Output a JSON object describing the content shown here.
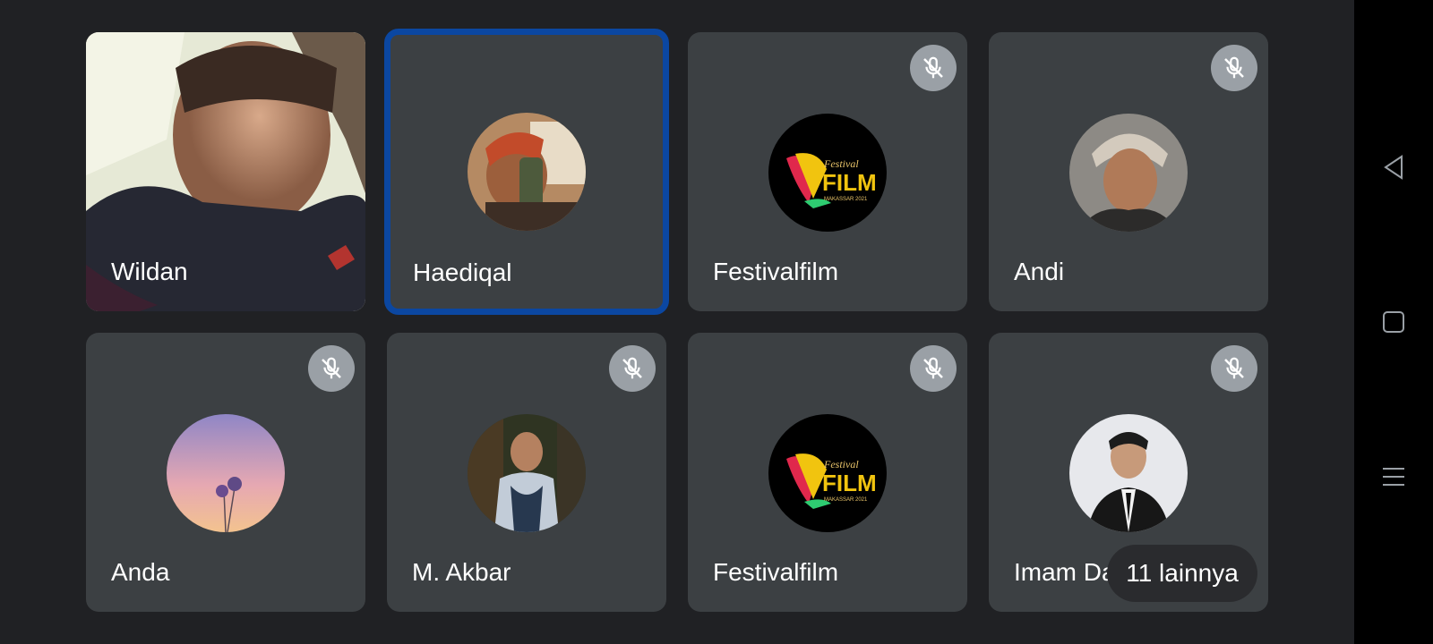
{
  "participants": [
    {
      "name": "Wildan",
      "muted": false,
      "display": "video",
      "avatar_icon": "camera-video-feed"
    },
    {
      "name": "Haediqal",
      "muted": false,
      "active_speaker": true,
      "display": "avatar",
      "avatar_icon": "person-avatar-photo"
    },
    {
      "name": "Festivalfilm",
      "muted": true,
      "display": "avatar",
      "avatar_icon": "festival-film-logo",
      "logo_text": {
        "top": "Festival",
        "main": "FILM",
        "sub": "MAKASSAR 2021"
      }
    },
    {
      "name": "Andi",
      "muted": true,
      "display": "avatar",
      "avatar_icon": "person-avatar-photo"
    },
    {
      "name": "Anda",
      "muted": true,
      "display": "avatar",
      "avatar_icon": "flower-avatar-photo"
    },
    {
      "name": "M. Akbar",
      "muted": true,
      "display": "avatar",
      "avatar_icon": "person-avatar-photo"
    },
    {
      "name": "Festivalfilm",
      "muted": true,
      "display": "avatar",
      "avatar_icon": "festival-film-logo",
      "logo_text": {
        "top": "Festival",
        "main": "FILM",
        "sub": "MAKASSAR 2021"
      }
    },
    {
      "name": "Imam Dahlan",
      "muted": true,
      "display": "avatar",
      "avatar_icon": "person-avatar-photo"
    }
  ],
  "overflow": {
    "label": "11 lainnya"
  },
  "system_nav": {
    "back_icon": "back-triangle-icon",
    "home_icon": "home-square-icon",
    "recents_icon": "menu-lines-icon"
  },
  "colors": {
    "background": "#202124",
    "tile": "#3c4043",
    "active_border": "#0b47a1",
    "mute_badge": "#9aa0a6"
  }
}
